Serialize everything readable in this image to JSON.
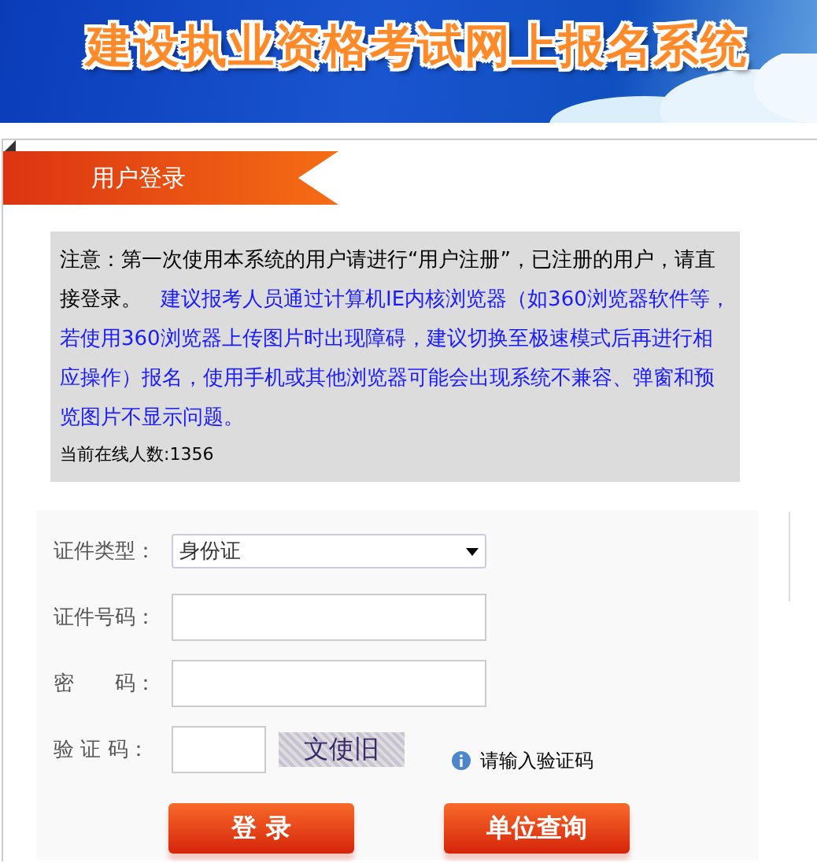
{
  "header": {
    "title": "建设执业资格考试网上报名系统"
  },
  "login_panel": {
    "title": "用户登录",
    "notice": {
      "text": "注意：第一次使用本系统的用户请进行“用户注册”，已注册的用户，请直接登录。",
      "advice": "建议报考人员通过计算机IE内核浏览器（如360浏览器软件等，若使用360浏览器上传图片时出现障碍，建议切换至极速模式后再进行相应操作）报名，使用手机或其他浏览器可能会出现系统不兼容、弹窗和预览图片不显示问题。",
      "online_count": "当前在线人数:1356"
    },
    "fields": [
      {
        "kind": "select",
        "label": "证件类型：",
        "value": "身份证"
      },
      {
        "kind": "input",
        "label": "证件号码："
      },
      {
        "kind": "password",
        "label": "密　　码："
      },
      {
        "kind": "captcha",
        "label": "验 证 码：",
        "captcha": "文使旧",
        "hint": "请输入验证码"
      }
    ],
    "buttons": [
      "登 录",
      "单位查询"
    ]
  }
}
